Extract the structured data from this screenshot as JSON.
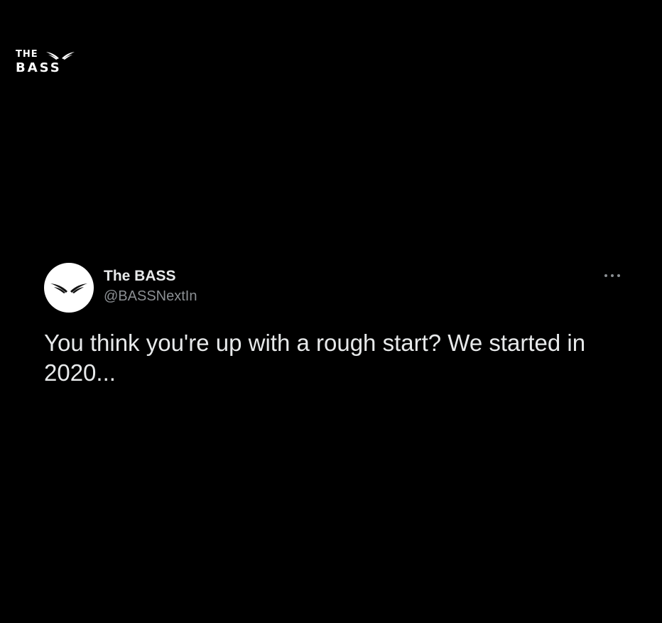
{
  "brand": {
    "logo_line1": "THE",
    "logo_line2": "BASS",
    "icon": "wings-icon"
  },
  "tweet": {
    "author": {
      "display_name": "The BASS",
      "handle": "@BASSNextIn",
      "avatar_icon": "wings-icon"
    },
    "more_icon": "more-options-icon",
    "text": "You think you're up with a rough start? We started in 2020..."
  },
  "colors": {
    "background": "#000000",
    "primary_text": "#e7e9ea",
    "secondary_text": "#8b8f93",
    "avatar_bg": "#ffffff"
  }
}
